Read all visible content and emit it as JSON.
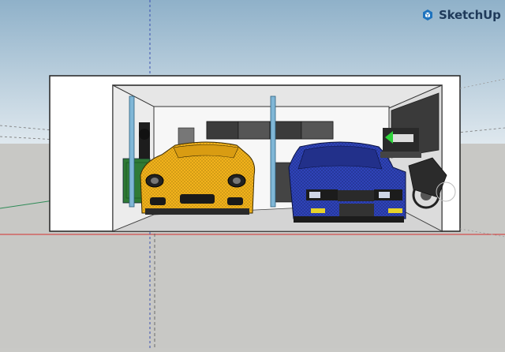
{
  "app": {
    "brand": "SketchUp"
  },
  "colors": {
    "sky_top": "#8fb1c9",
    "sky_bottom": "#d9e3ea",
    "ground": "#c8c8c5",
    "red_axis": "#d32f2f",
    "green_axis": "#2e8b57",
    "blue_axis": "#3a4fb0",
    "porsche": "#f2b21c",
    "bmw": "#2f43b8",
    "pillar": "#7fb6d6",
    "brand_icon": "#1e73be"
  },
  "icons": {
    "brand": "sketchup-logo-icon"
  }
}
